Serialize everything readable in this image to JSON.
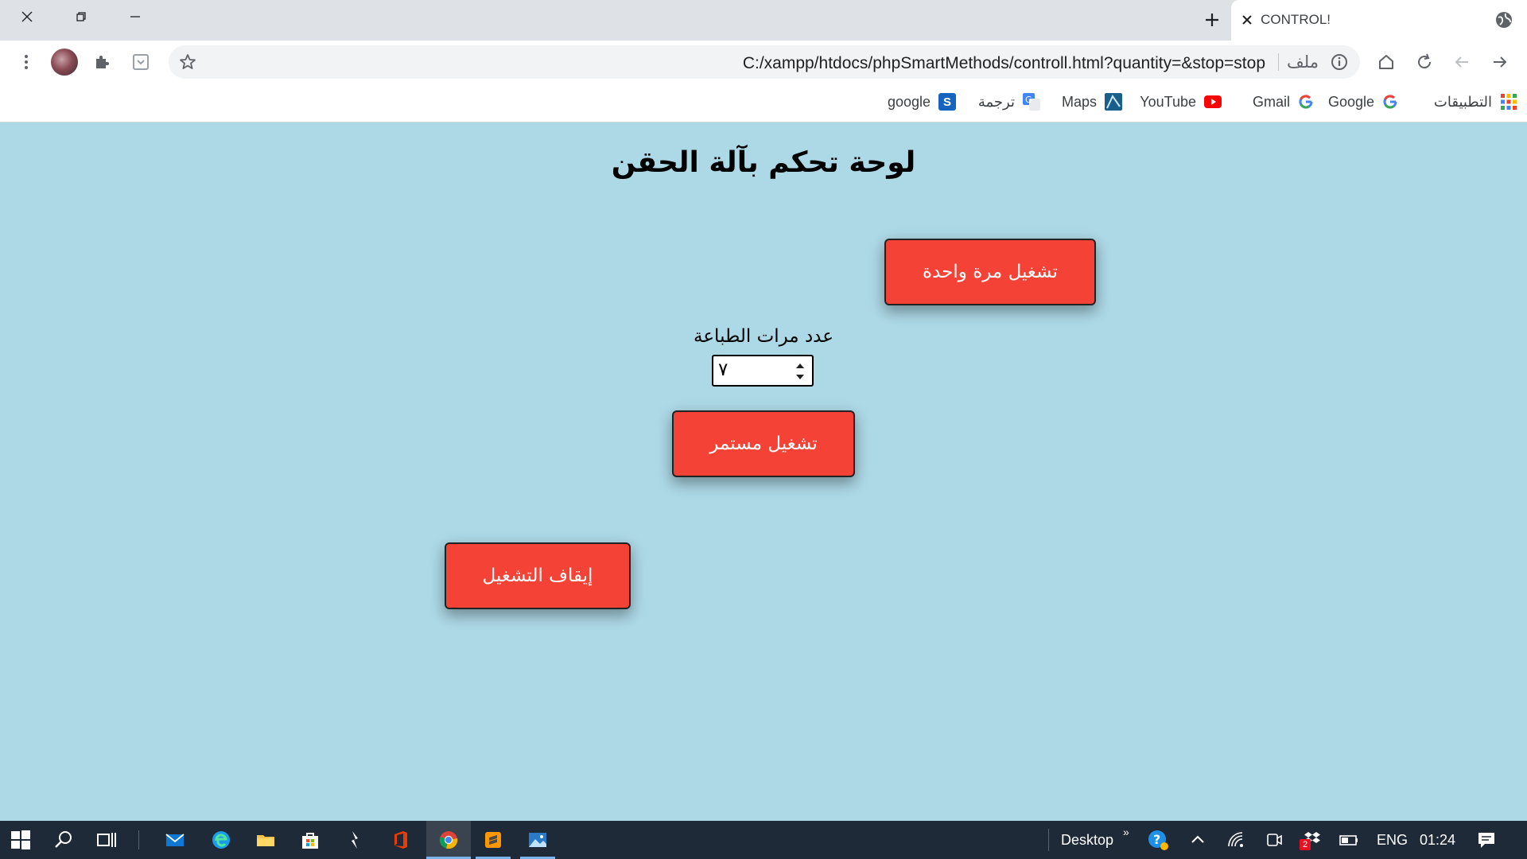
{
  "browser": {
    "tab": {
      "title": "CONTROL!"
    },
    "address_bar": {
      "url": "C:/xampp/htdocs/phpSmartMethods/controll.html?quantity=&stop=stop",
      "scheme_label": "ملف"
    },
    "bookmarks": [
      {
        "label": "التطبيقات",
        "icon": "apps-grid-icon"
      },
      {
        "label": "Google",
        "icon": "google-g-icon"
      },
      {
        "label": "Gmail",
        "icon": "google-g-icon"
      },
      {
        "label": "YouTube",
        "icon": "youtube-icon"
      },
      {
        "label": "Maps",
        "icon": "maps-icon"
      },
      {
        "label": "ترجمة",
        "icon": "translate-icon"
      },
      {
        "label": "google",
        "icon": "s-icon"
      }
    ]
  },
  "page": {
    "title": "لوحة تحكم بآلة الحقن",
    "run_once_button": "تشغيل مرة واحدة",
    "quantity_label": "عدد مرات الطباعة",
    "quantity_value": "٧",
    "run_continuous_button": "تشغيل مستمر",
    "stop_button": "إيقاف التشغيل",
    "colors": {
      "background": "#add8e6",
      "button": "#f44336"
    }
  },
  "taskbar": {
    "desktop_label": "Desktop",
    "language": "ENG",
    "time": "01:24",
    "notification_badge": "2"
  }
}
